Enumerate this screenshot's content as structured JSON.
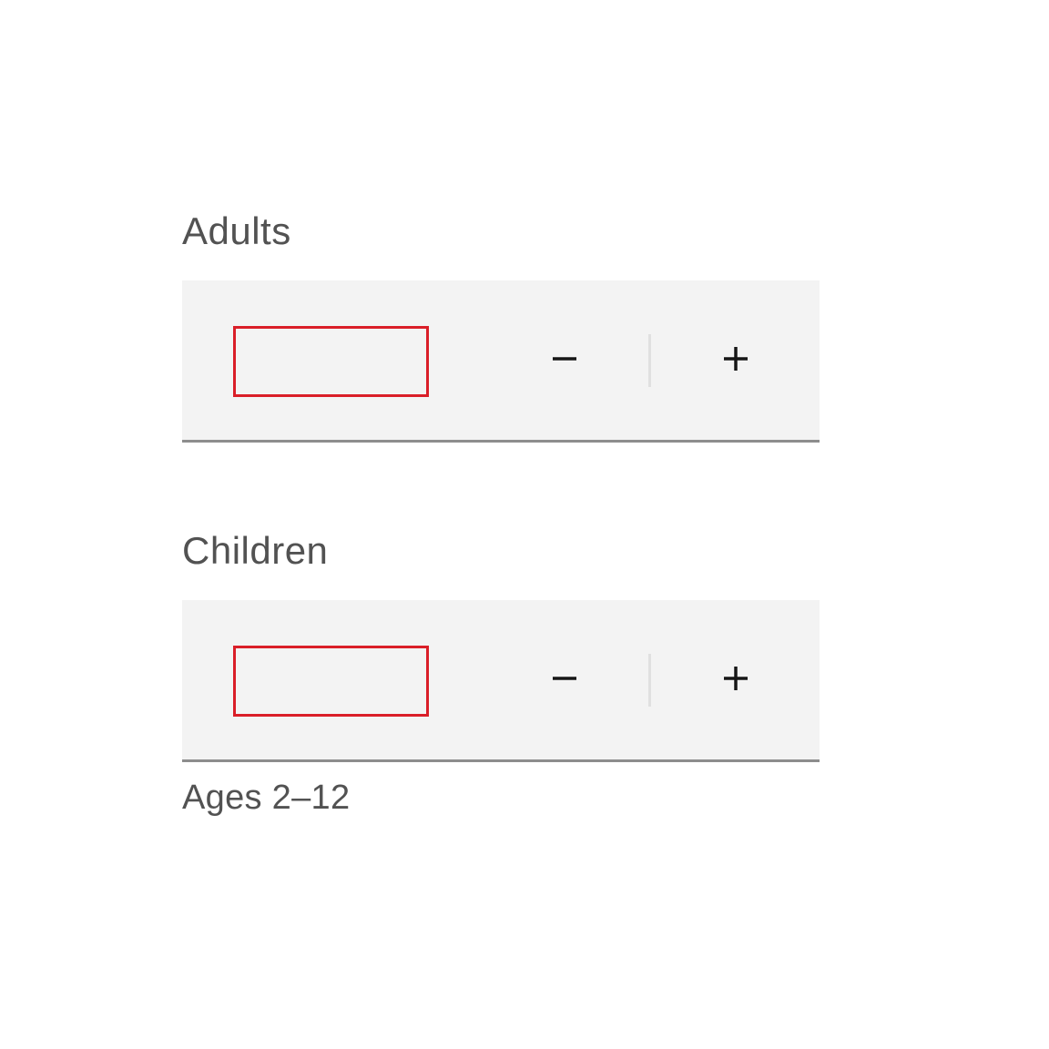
{
  "adults": {
    "label": "Adults",
    "value": "",
    "helper": ""
  },
  "children": {
    "label": "Children",
    "value": "",
    "helper": "Ages 2–12"
  }
}
